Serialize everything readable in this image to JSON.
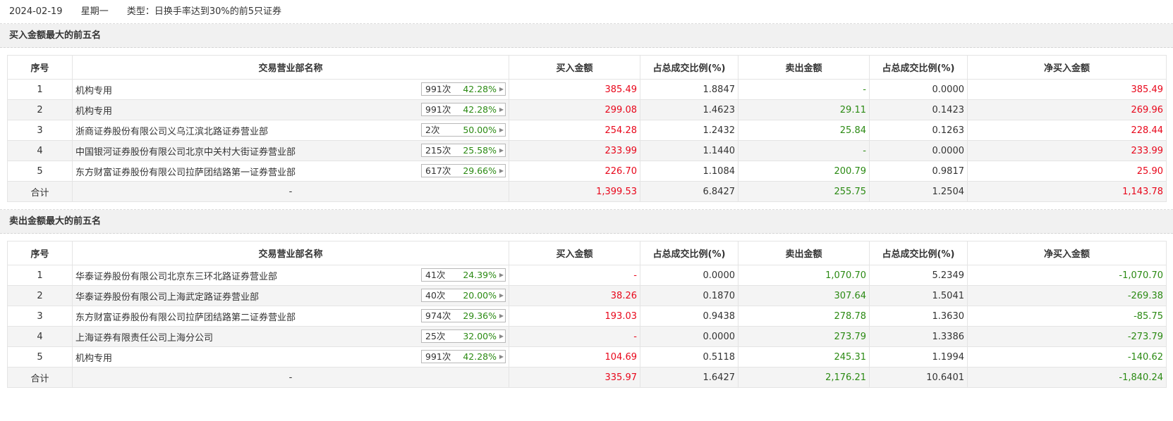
{
  "header": {
    "date": "2024-02-19",
    "weekday": "星期一",
    "type_label": "类型：日换手率达到30%的前5只证券"
  },
  "columns": [
    "序号",
    "交易营业部名称",
    "买入金额",
    "占总成交比例(%)",
    "卖出金额",
    "占总成交比例(%)",
    "净买入金额"
  ],
  "buy_section": {
    "title": "买入金额最大的前五名",
    "rows": [
      {
        "rank": "1",
        "name": "机构专用",
        "count": "991次",
        "rate": "42.28%",
        "buy": "385.49",
        "buy_ratio": "1.8847",
        "sell": "-",
        "sell_ratio": "0.0000",
        "net": "385.49"
      },
      {
        "rank": "2",
        "name": "机构专用",
        "count": "991次",
        "rate": "42.28%",
        "buy": "299.08",
        "buy_ratio": "1.4623",
        "sell": "29.11",
        "sell_ratio": "0.1423",
        "net": "269.96"
      },
      {
        "rank": "3",
        "name": "浙商证券股份有限公司义乌江滨北路证券营业部",
        "count": "2次",
        "rate": "50.00%",
        "buy": "254.28",
        "buy_ratio": "1.2432",
        "sell": "25.84",
        "sell_ratio": "0.1263",
        "net": "228.44"
      },
      {
        "rank": "4",
        "name": "中国银河证券股份有限公司北京中关村大街证券营业部",
        "count": "215次",
        "rate": "25.58%",
        "buy": "233.99",
        "buy_ratio": "1.1440",
        "sell": "-",
        "sell_ratio": "0.0000",
        "net": "233.99"
      },
      {
        "rank": "5",
        "name": "东方财富证券股份有限公司拉萨团结路第一证券营业部",
        "count": "617次",
        "rate": "29.66%",
        "buy": "226.70",
        "buy_ratio": "1.1084",
        "sell": "200.79",
        "sell_ratio": "0.9817",
        "net": "25.90"
      }
    ],
    "total": {
      "label": "合计",
      "name": "-",
      "buy": "1,399.53",
      "buy_ratio": "6.8427",
      "sell": "255.75",
      "sell_ratio": "1.2504",
      "net": "1,143.78"
    }
  },
  "sell_section": {
    "title": "卖出金额最大的前五名",
    "rows": [
      {
        "rank": "1",
        "name": "华泰证券股份有限公司北京东三环北路证券营业部",
        "count": "41次",
        "rate": "24.39%",
        "buy": "-",
        "buy_ratio": "0.0000",
        "sell": "1,070.70",
        "sell_ratio": "5.2349",
        "net": "-1,070.70"
      },
      {
        "rank": "2",
        "name": "华泰证券股份有限公司上海武定路证券营业部",
        "count": "40次",
        "rate": "20.00%",
        "buy": "38.26",
        "buy_ratio": "0.1870",
        "sell": "307.64",
        "sell_ratio": "1.5041",
        "net": "-269.38"
      },
      {
        "rank": "3",
        "name": "东方财富证券股份有限公司拉萨团结路第二证券营业部",
        "count": "974次",
        "rate": "29.36%",
        "buy": "193.03",
        "buy_ratio": "0.9438",
        "sell": "278.78",
        "sell_ratio": "1.3630",
        "net": "-85.75"
      },
      {
        "rank": "4",
        "name": "上海证券有限责任公司上海分公司",
        "count": "25次",
        "rate": "32.00%",
        "buy": "-",
        "buy_ratio": "0.0000",
        "sell": "273.79",
        "sell_ratio": "1.3386",
        "net": "-273.79"
      },
      {
        "rank": "5",
        "name": "机构专用",
        "count": "991次",
        "rate": "42.28%",
        "buy": "104.69",
        "buy_ratio": "0.5118",
        "sell": "245.31",
        "sell_ratio": "1.1994",
        "net": "-140.62"
      }
    ],
    "total": {
      "label": "合计",
      "name": "-",
      "buy": "335.97",
      "buy_ratio": "1.6427",
      "sell": "2,176.21",
      "sell_ratio": "10.6401",
      "net": "-1,840.24"
    }
  },
  "colors": {
    "up": "#e8071b",
    "down": "#2b8a13",
    "text": "#333333",
    "stripe": "#f4f4f4"
  }
}
